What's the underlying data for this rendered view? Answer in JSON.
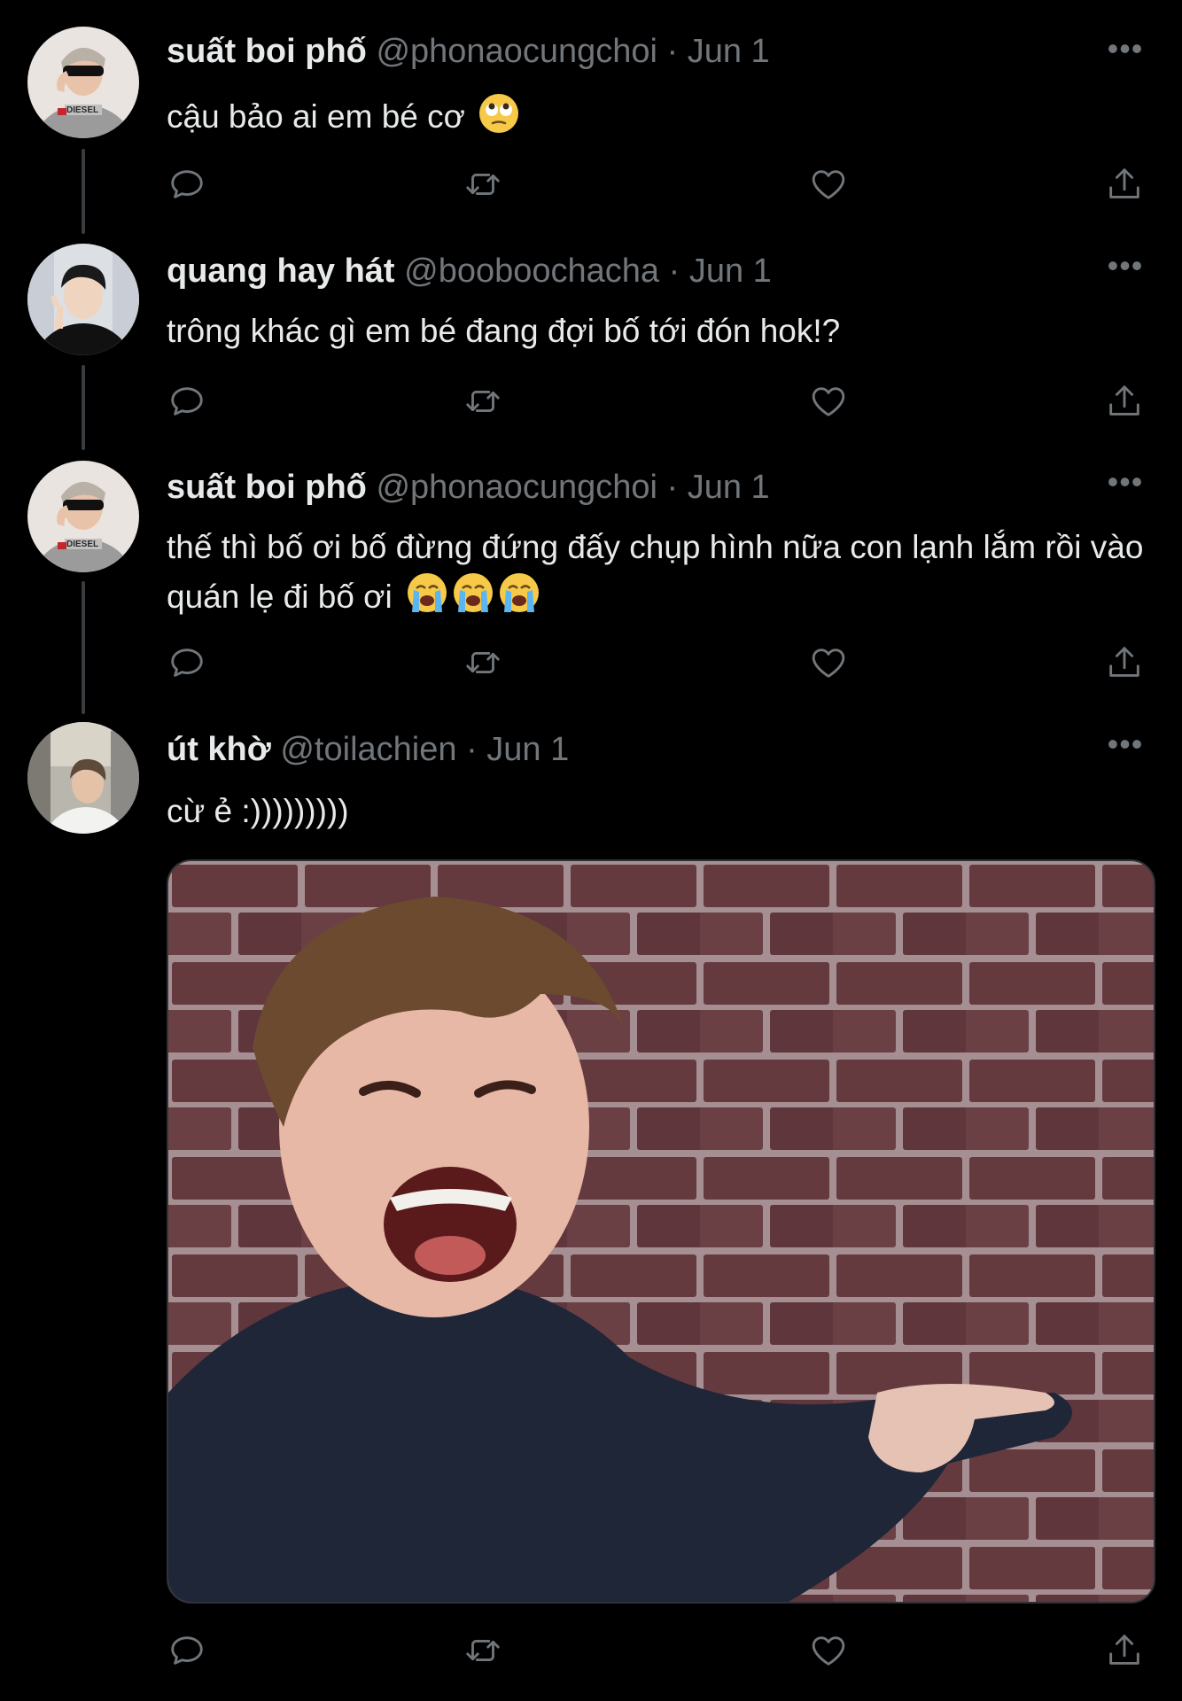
{
  "tweets": [
    {
      "name": "suất boi phố",
      "handle": "@phonaocungchoi",
      "dot": "·",
      "date": "Jun 1",
      "text": "cậu bảo ai em bé cơ",
      "emoji": "face-with-rolling-eyes",
      "avatar": "avatar-diesel-sunglasses"
    },
    {
      "name": "quang hay hát",
      "handle": "@booboochacha",
      "dot": "·",
      "date": "Jun 1",
      "text": "trông khác gì em bé đang đợi bố tới đón hok!?",
      "avatar": "avatar-boy-peace-sign"
    },
    {
      "name": "suất boi phố",
      "handle": "@phonaocungchoi",
      "dot": "·",
      "date": "Jun 1",
      "text": "thế thì bố ơi bố đừng đứng đấy chụp hình nữa con lạnh lắm rồi vào quán lẹ đi bố ơi",
      "emoji": "loudly-crying-face x3",
      "avatar": "avatar-diesel-sunglasses"
    },
    {
      "name": "út khờ",
      "handle": "@toilachien",
      "dot": "·",
      "date": "Jun 1",
      "text": "cừ ẻ :)))))))))",
      "avatar": "avatar-street-photo",
      "media": "meme-shouting-pointing-brick-wall"
    }
  ],
  "more_label": "•••",
  "action_icons": [
    "reply-icon",
    "retweet-icon",
    "like-icon",
    "share-icon"
  ],
  "colors": {
    "background": "#000000",
    "text": "#e7e9ea",
    "secondary": "#71767b",
    "thread_line": "#3a3d40"
  }
}
